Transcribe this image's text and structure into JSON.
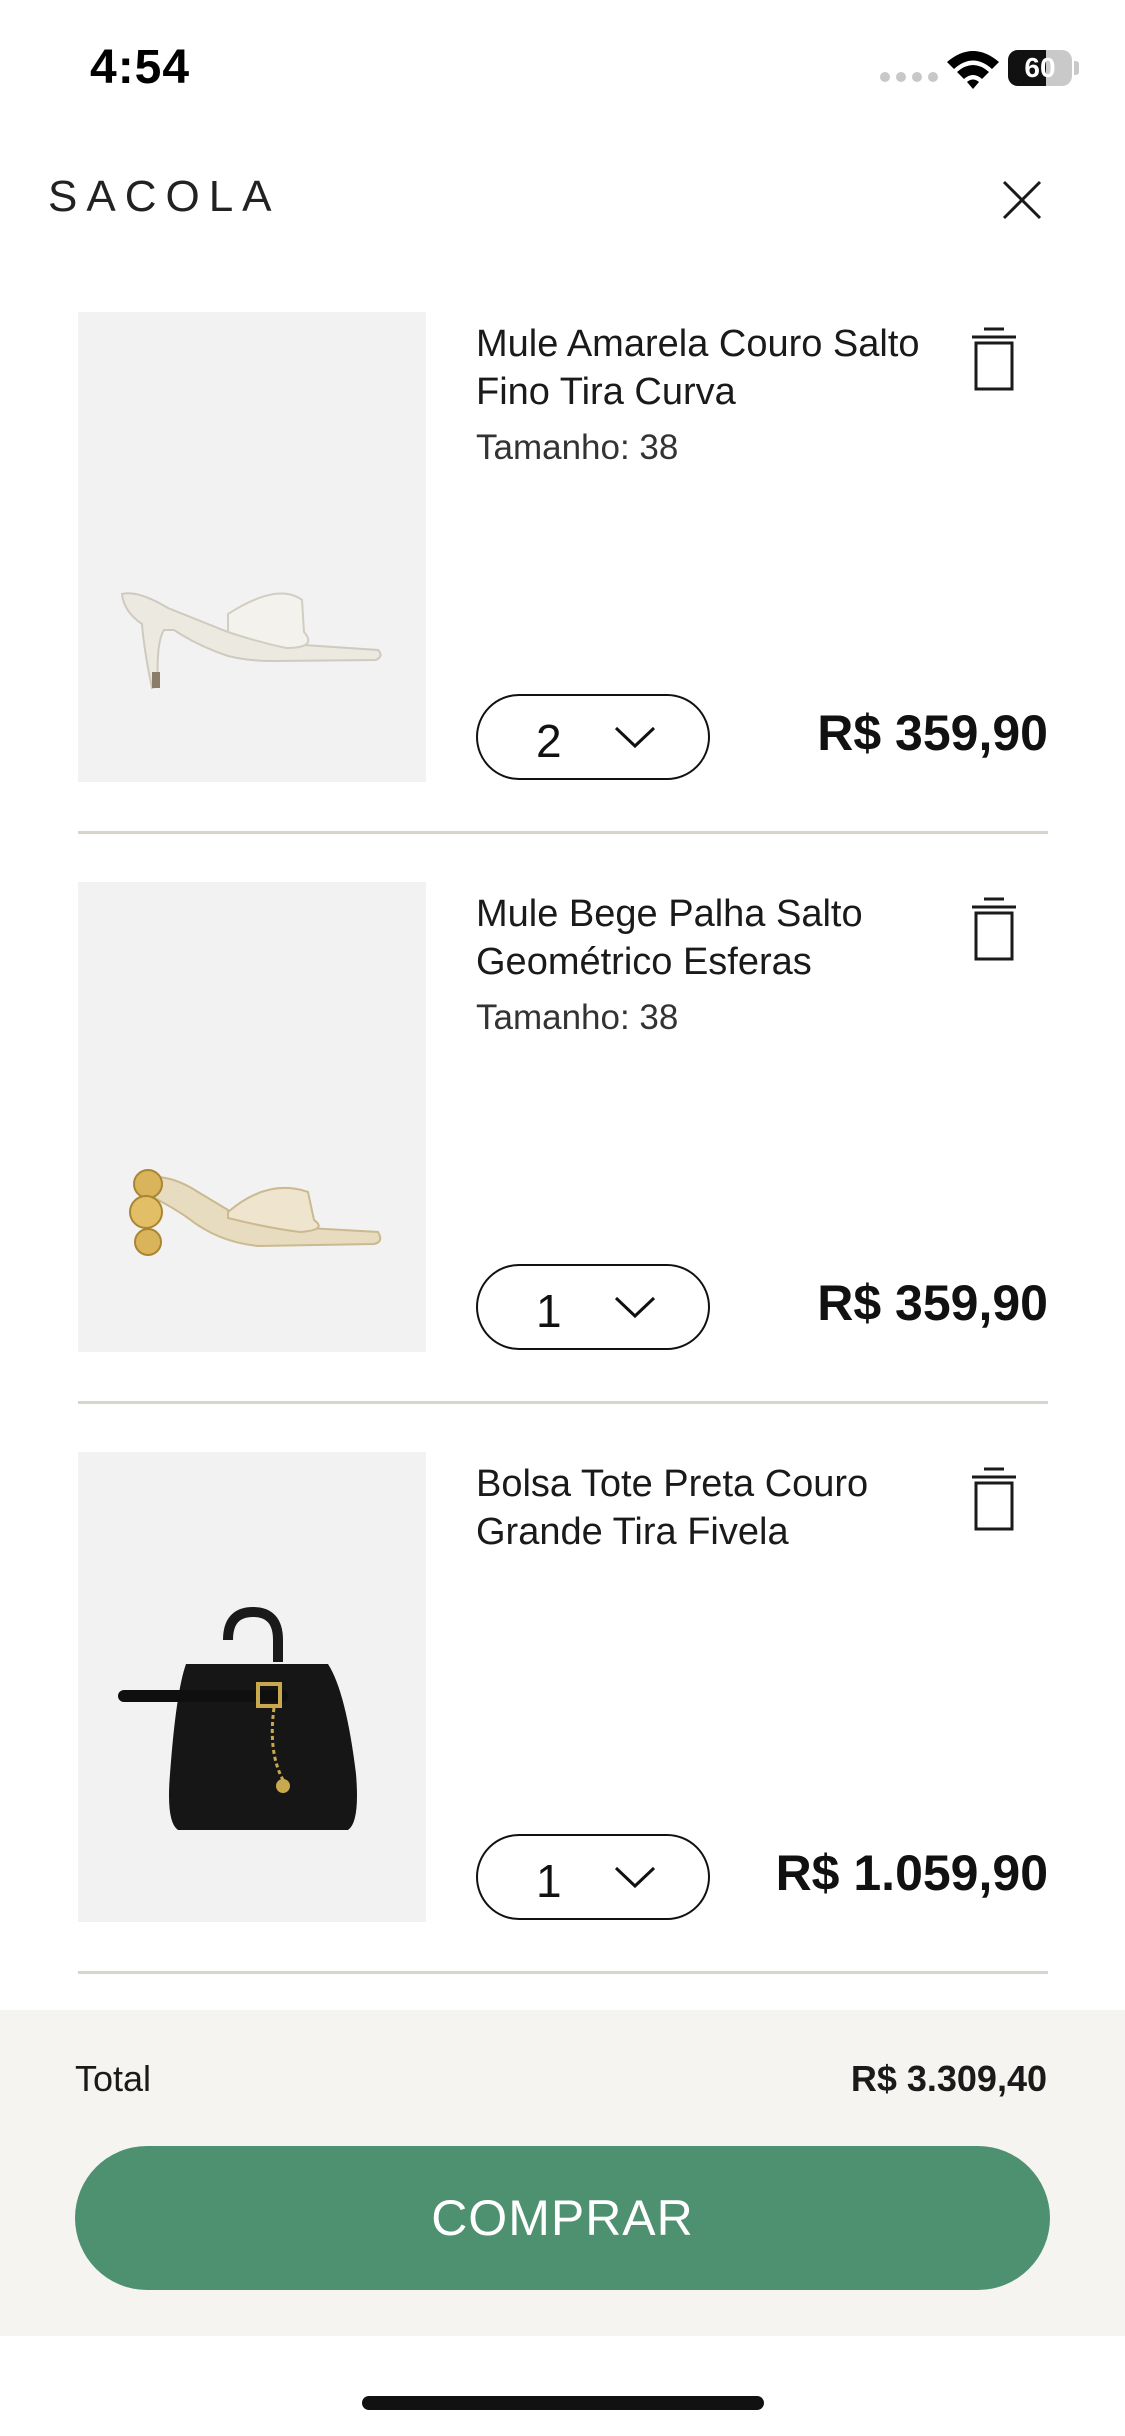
{
  "status_bar": {
    "time": "4:54",
    "battery": "60",
    "battery_level": 0.6
  },
  "header": {
    "title": "SACOLA"
  },
  "items": [
    {
      "name": "Mule Amarela Couro Salto Fino Tira Curva",
      "size": "Tamanho: 38",
      "quantity": "2",
      "price": "R$ 359,90"
    },
    {
      "name": "Mule Bege Palha Salto Geométrico Esferas",
      "size": "Tamanho: 38",
      "quantity": "1",
      "price": "R$ 359,90"
    },
    {
      "name": "Bolsa Tote Preta Couro Grande Tira Fivela",
      "size": "",
      "quantity": "1",
      "price": "R$ 1.059,90"
    }
  ],
  "footer": {
    "total_label": "Total",
    "total_value": "R$ 3.309,40",
    "buy_label": "COMPRAR"
  },
  "colors": {
    "accent": "#4e9170",
    "footer_bg": "#f5f4f1",
    "image_bg": "#f2f2f2",
    "divider": "#d9d5cc"
  },
  "icons": [
    "close-icon",
    "trash-icon",
    "chevron-down-icon",
    "wifi-icon",
    "battery-icon",
    "signal-icon"
  ]
}
